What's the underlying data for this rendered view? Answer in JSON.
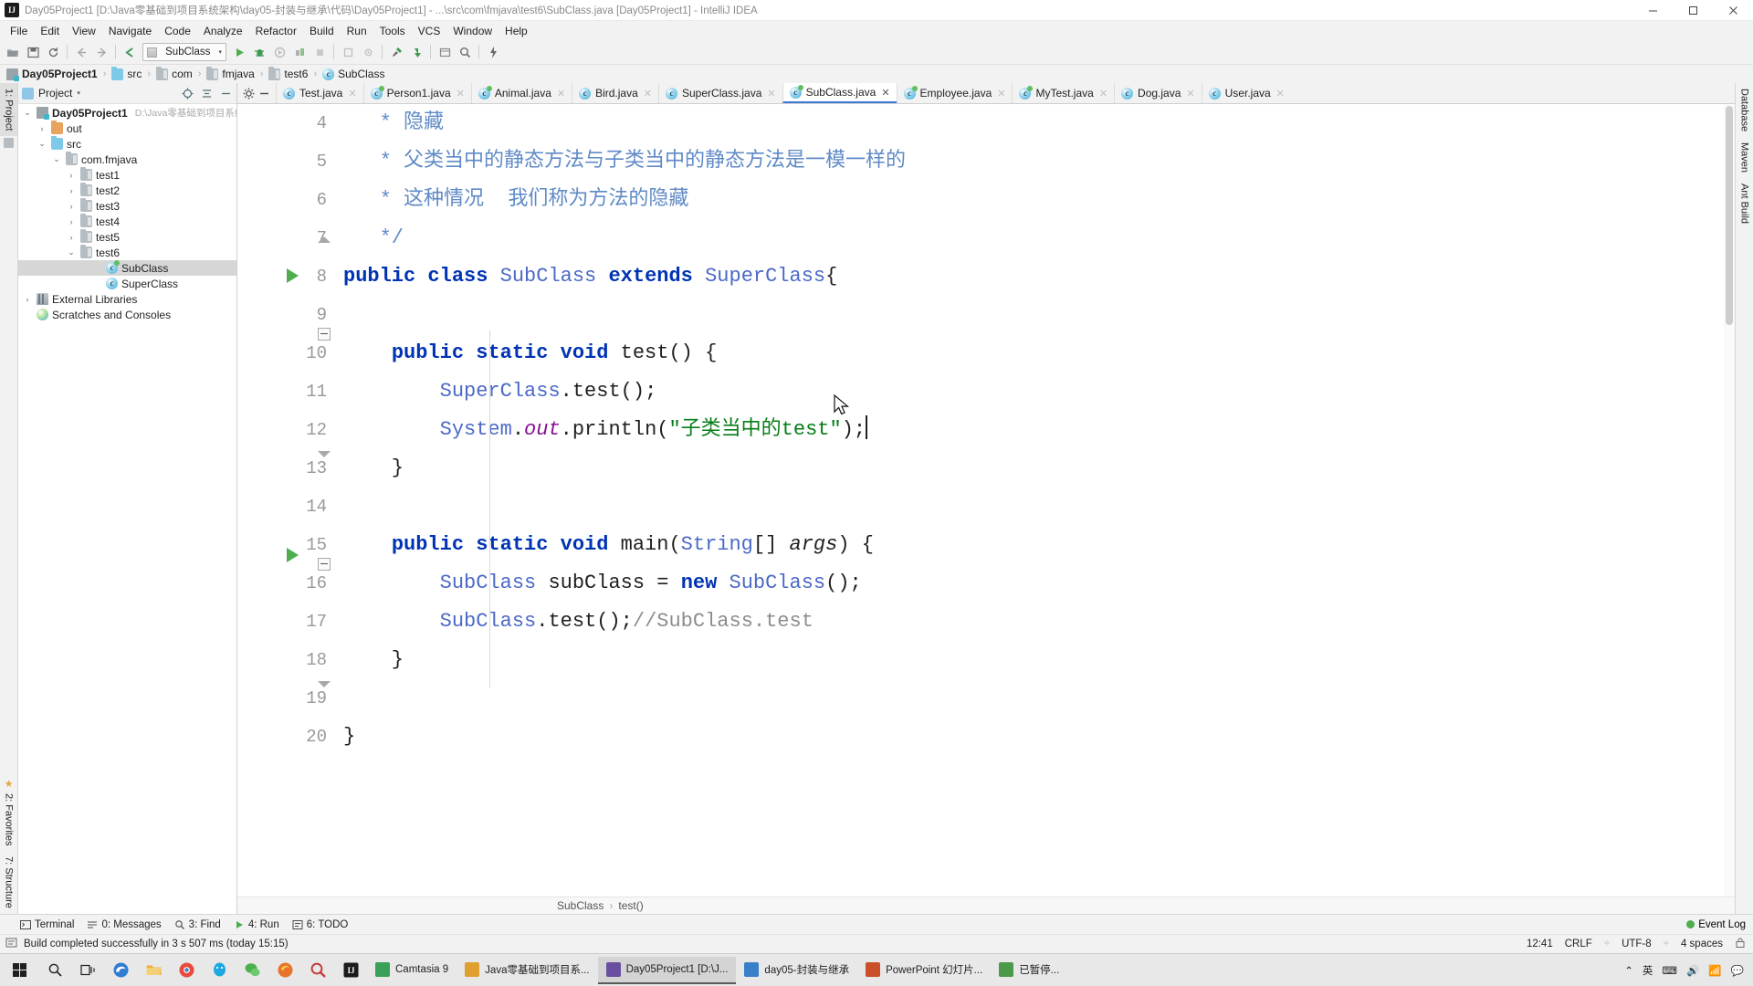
{
  "window": {
    "title": "Day05Project1 [D:\\Java零基础到项目系统架构\\day05-封装与继承\\代码\\Day05Project1] - ...\\src\\com\\fmjava\\test6\\SubClass.java [Day05Project1] - IntelliJ IDEA",
    "logo_text": "IJ",
    "minimize": "minimize-icon",
    "maximize": "maximize-icon",
    "close": "close-icon"
  },
  "menubar": {
    "items": [
      "File",
      "Edit",
      "View",
      "Navigate",
      "Code",
      "Analyze",
      "Refactor",
      "Build",
      "Run",
      "Tools",
      "VCS",
      "Window",
      "Help"
    ]
  },
  "toolbar": {
    "run_config": "SubClass",
    "run_config_arrow": "▾",
    "icons": [
      "open-folder-icon",
      "save-all-icon",
      "sync-icon",
      "back-arrow-icon",
      "forward-arrow-icon",
      "jump-to-source-icon",
      "run-icon",
      "debug-icon",
      "run-with-coverage-icon",
      "profile-icon",
      "stop-icon",
      "attach-icon",
      "settings-icon",
      "build-icon",
      "update-project-icon",
      "commit-icon",
      "search-everywhere-icon",
      "flash-icon"
    ]
  },
  "breadcrumb": {
    "items": [
      {
        "label": "Day05Project1",
        "icon": "module-icon",
        "bold": true
      },
      {
        "label": "src",
        "icon": "source-folder-icon",
        "bold": false
      },
      {
        "label": "com",
        "icon": "package-folder-icon",
        "bold": false
      },
      {
        "label": "fmjava",
        "icon": "package-folder-icon",
        "bold": false
      },
      {
        "label": "test6",
        "icon": "package-folder-icon",
        "bold": false
      },
      {
        "label": "SubClass",
        "icon": "java-class-icon",
        "bold": false
      }
    ],
    "separator": "›"
  },
  "left_strip": {
    "project_tab": "1: Project",
    "favorites_tab": "2: Favorites",
    "structure_tab": "7: Structure"
  },
  "right_strip": {
    "database_tab": "Database",
    "maven_tab": "Maven",
    "ant_build_tab": "Ant Build"
  },
  "project_panel": {
    "header_title": "Project",
    "header_arrow": "▾",
    "locate_icon": "locate-icon",
    "collapse_icon": "collapse-all-icon",
    "hide_icon": "hide-icon",
    "tree": [
      {
        "label": "Day05Project1",
        "path": "D:\\Java零基础到项目系统",
        "twist": "⌄",
        "icon": "module-icon",
        "indent": 0,
        "bold": true,
        "selected": false
      },
      {
        "label": "out",
        "path": "",
        "twist": "›",
        "icon": "excluded-folder-icon",
        "indent": 1,
        "bold": false,
        "selected": false
      },
      {
        "label": "src",
        "path": "",
        "twist": "⌄",
        "icon": "source-folder-icon",
        "indent": 1,
        "bold": false,
        "selected": false
      },
      {
        "label": "com.fmjava",
        "path": "",
        "twist": "⌄",
        "icon": "package-folder-icon",
        "indent": 2,
        "bold": false,
        "selected": false
      },
      {
        "label": "test1",
        "path": "",
        "twist": "›",
        "icon": "package-folder-icon",
        "indent": 3,
        "bold": false,
        "selected": false
      },
      {
        "label": "test2",
        "path": "",
        "twist": "›",
        "icon": "package-folder-icon",
        "indent": 3,
        "bold": false,
        "selected": false
      },
      {
        "label": "test3",
        "path": "",
        "twist": "›",
        "icon": "package-folder-icon",
        "indent": 3,
        "bold": false,
        "selected": false
      },
      {
        "label": "test4",
        "path": "",
        "twist": "›",
        "icon": "package-folder-icon",
        "indent": 3,
        "bold": false,
        "selected": false
      },
      {
        "label": "test5",
        "path": "",
        "twist": "›",
        "icon": "package-folder-icon",
        "indent": 3,
        "bold": false,
        "selected": false
      },
      {
        "label": "test6",
        "path": "",
        "twist": "⌄",
        "icon": "package-folder-icon",
        "indent": 3,
        "bold": false,
        "selected": false
      },
      {
        "label": "SubClass",
        "path": "",
        "twist": "",
        "icon": "java-class-icon",
        "indent": 4,
        "bold": false,
        "selected": true
      },
      {
        "label": "SuperClass",
        "path": "",
        "twist": "",
        "icon": "java-class-icon",
        "indent": 4,
        "bold": false,
        "selected": false
      },
      {
        "label": "External Libraries",
        "path": "",
        "twist": "›",
        "icon": "library-icon",
        "indent": 0,
        "bold": false,
        "selected": false
      },
      {
        "label": "Scratches and Consoles",
        "path": "",
        "twist": "",
        "icon": "scratch-icon",
        "indent": 0,
        "bold": false,
        "selected": false
      }
    ]
  },
  "editor_tabs": {
    "settings_icon": "gear-icon",
    "hide_icon": "minus-icon",
    "tabs": [
      {
        "label": "Test.java",
        "active": false,
        "modified": false
      },
      {
        "label": "Person1.java",
        "active": false,
        "modified": true
      },
      {
        "label": "Animal.java",
        "active": false,
        "modified": true
      },
      {
        "label": "Bird.java",
        "active": false,
        "modified": false
      },
      {
        "label": "SuperClass.java",
        "active": false,
        "modified": false
      },
      {
        "label": "SubClass.java",
        "active": true,
        "modified": true
      },
      {
        "label": "Employee.java",
        "active": false,
        "modified": true
      },
      {
        "label": "MyTest.java",
        "active": false,
        "modified": true
      },
      {
        "label": "Dog.java",
        "active": false,
        "modified": false
      },
      {
        "label": "User.java",
        "active": false,
        "modified": false
      }
    ]
  },
  "code": {
    "first_visible_line": 4,
    "lines": [
      {
        "n": 4,
        "html": "   <span class='doc'>* 隐藏</span>",
        "run": false,
        "fold": ""
      },
      {
        "n": 5,
        "html": "   <span class='doc'>* 父类当中的静态方法与子类当中的静态方法是一模一样的</span>",
        "run": false,
        "fold": ""
      },
      {
        "n": 6,
        "html": "   <span class='doc'>* 这种情况  我们称为方法的隐藏</span>",
        "run": false,
        "fold": ""
      },
      {
        "n": 7,
        "html": "   <span class='doc'>*/</span>",
        "run": false,
        "fold": "cap"
      },
      {
        "n": 8,
        "html": "<span class='kw'>public class </span><span class='cls'>SubClass</span> <span class='kw'>extends </span><span class='cls'>SuperClass</span>{",
        "run": true,
        "fold": ""
      },
      {
        "n": 9,
        "html": "",
        "run": false,
        "fold": ""
      },
      {
        "n": 10,
        "html": "    <span class='kw'>public static void </span><span class='mth'>test</span>() {",
        "run": false,
        "fold": "open"
      },
      {
        "n": 11,
        "html": "        <span class='cls'>SuperClass</span>.<span class='mth'>test</span>();",
        "run": false,
        "fold": ""
      },
      {
        "n": 12,
        "html": "        <span class='cls'>System</span>.<span class='fld'>out</span>.<span class='mth'>println</span>(<span class='str'>\"子类当中的test\"</span>);<span class='caret'></span>",
        "run": false,
        "fold": ""
      },
      {
        "n": 13,
        "html": "    }",
        "run": false,
        "fold": "capb"
      },
      {
        "n": 14,
        "html": "",
        "run": false,
        "fold": ""
      },
      {
        "n": 15,
        "html": "    <span class='kw'>public static void </span><span class='mth'>main</span>(<span class='cls'>String</span>[] <span class='param'>args</span>) {",
        "run": true,
        "fold": "open"
      },
      {
        "n": 16,
        "html": "        <span class='cls'>SubClass</span> subClass = <span class='kw'>new </span><span class='cls'>SubClass</span>();",
        "run": false,
        "fold": ""
      },
      {
        "n": 17,
        "html": "        <span class='cls'>SubClass</span>.<span class='mth'>test</span>();<span class='cmt'>//SubClass.test</span>",
        "run": false,
        "fold": ""
      },
      {
        "n": 18,
        "html": "    }",
        "run": false,
        "fold": "capb"
      },
      {
        "n": 19,
        "html": "",
        "run": false,
        "fold": ""
      },
      {
        "n": 20,
        "html": "}",
        "run": false,
        "fold": ""
      }
    ]
  },
  "code_breadcrumb": {
    "items": [
      "SubClass",
      "test()"
    ],
    "separator": "›"
  },
  "tool_window_bar": {
    "items": [
      {
        "label": "Terminal",
        "icon": "terminal-icon"
      },
      {
        "label": "0: Messages",
        "icon": "messages-icon"
      },
      {
        "label": "3: Find",
        "icon": "find-icon"
      },
      {
        "label": "4: Run",
        "icon": "run-icon"
      },
      {
        "label": "6: TODO",
        "icon": "todo-icon"
      }
    ],
    "event_log": "Event Log"
  },
  "statusbar": {
    "message": "Build completed successfully in 3 s 507 ms (today 15:15)",
    "caret_position": "12:41",
    "line_separator": "CRLF",
    "encoding": "UTF-8",
    "indent": "4 spaces",
    "lock_icon": "lock-icon",
    "separator": "÷"
  },
  "taskbar": {
    "start_icon": "windows-start-icon",
    "search_icon": "search-icon",
    "taskview_icon": "task-view-icon",
    "pinned": [
      {
        "name": "edge-icon",
        "color": "#2f7dd1"
      },
      {
        "name": "folder-explorer-icon",
        "color": "#e8b040"
      },
      {
        "name": "chrome-icon",
        "color": "#e84a3d"
      },
      {
        "name": "qq-icon",
        "color": "#1fa7e0"
      },
      {
        "name": "wechat-icon",
        "color": "#4caf50"
      },
      {
        "name": "firefox-icon",
        "color": "#e8732a"
      },
      {
        "name": "search-app-icon",
        "color": "#c43c3c"
      },
      {
        "name": "idea-icon",
        "color": "#1b1b1b"
      }
    ],
    "apps": [
      {
        "label": "Camtasia 9",
        "active": false,
        "color": "#3aa05a"
      },
      {
        "label": "Java零基础到项目系...",
        "active": false,
        "color": "#e0a030"
      },
      {
        "label": "Day05Project1 [D:\\J...",
        "active": true,
        "color": "#6a4fa0"
      },
      {
        "label": "day05-封装与继承",
        "active": false,
        "color": "#3a7fc9"
      },
      {
        "label": "PowerPoint 幻灯片...",
        "active": false,
        "color": "#c9502a"
      },
      {
        "label": "已暂停...",
        "active": false,
        "color": "#4a9a4a"
      }
    ],
    "tray": {
      "caret": "⌃",
      "ime": "英",
      "ime2": "⌨",
      "sound": "🔊",
      "network": "📶",
      "notify": "💬"
    }
  }
}
